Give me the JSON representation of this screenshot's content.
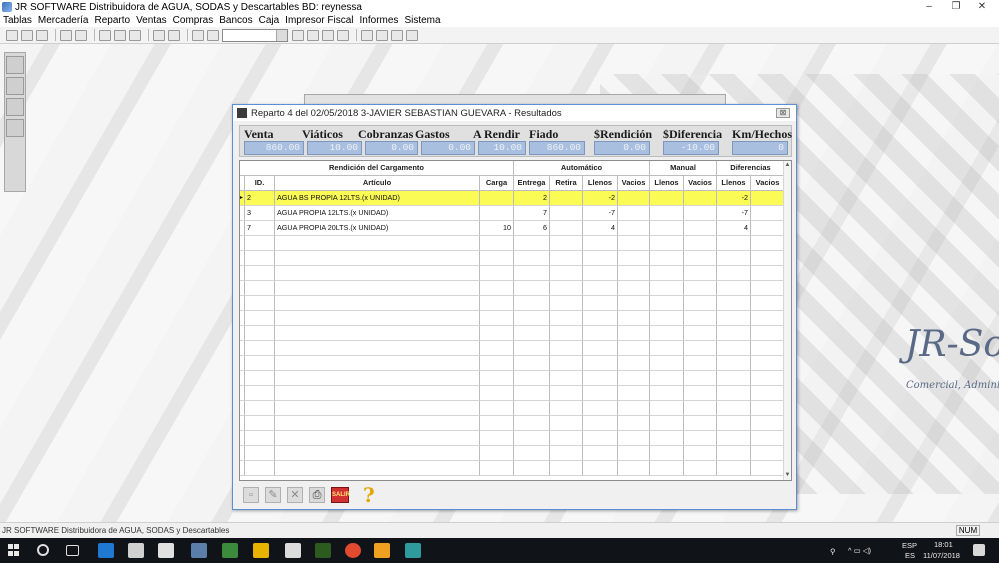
{
  "app": {
    "title": "JR SOFTWARE Distribuidora de AGUA, SODAS y Descartables BD: reynessa",
    "window_controls": [
      "–",
      "❐",
      "✕"
    ]
  },
  "menu": [
    "Tablas",
    "Mercadería",
    "Reparto",
    "Ventas",
    "Compras",
    "Bancos",
    "Caja",
    "Impresor Fiscal",
    "Informes",
    "Sistema"
  ],
  "branding": {
    "logo_text": "JR-So",
    "subtitle": "Comercial, Administr"
  },
  "dialog": {
    "title": "Reparto 4 del 02/05/2018 3-JAVIER SEBASTIAN GUEVARA - Resultados",
    "close_label": "⊠",
    "summary": {
      "venta": {
        "label": "Venta",
        "value": "860.00"
      },
      "viaticos": {
        "label": "Viáticos",
        "value": "10.00"
      },
      "cobranzas": {
        "label": "Cobranzas",
        "value": "0.00"
      },
      "gastos": {
        "label": "Gastos",
        "value": "0.00"
      },
      "a_rendir": {
        "label": "A Rendir",
        "value": "10.00"
      },
      "fiado": {
        "label": "Fiado",
        "value": "860.00"
      },
      "rendicion": {
        "label": "$Rendición",
        "value": "0.00"
      },
      "diferencia": {
        "label": "$Diferencia",
        "value": "-10.00"
      },
      "km_hechos": {
        "label": "Km/Hechos",
        "value": "0"
      }
    },
    "grid": {
      "groups": {
        "rendicion": "Rendición del Cargamento",
        "automatico": "Automático",
        "manual": "Manual",
        "diferencias": "Diferencias"
      },
      "columns": [
        "ID.",
        "Artículo",
        "Carga",
        "Entrega",
        "Retira",
        "Llenos",
        "Vacios",
        "Llenos",
        "Vacios",
        "Llenos",
        "Vacios"
      ],
      "rows": [
        {
          "id": "2",
          "articulo": "AGUA BS PROPIA 12LTS.(x UNIDAD)",
          "carga": "",
          "entrega": "2",
          "retira": "",
          "auto_llenos": "-2",
          "auto_vacios": "",
          "man_llenos": "",
          "man_vacios": "",
          "dif_llenos": "-2",
          "dif_vacios": "",
          "selected": true
        },
        {
          "id": "3",
          "articulo": "AGUA PROPIA 12LTS.(x UNIDAD)",
          "carga": "",
          "entrega": "7",
          "retira": "",
          "auto_llenos": "-7",
          "auto_vacios": "",
          "man_llenos": "",
          "man_vacios": "",
          "dif_llenos": "-7",
          "dif_vacios": "",
          "selected": false
        },
        {
          "id": "7",
          "articulo": "AGUA PROPIA 20LTS.(x UNIDAD)",
          "carga": "10",
          "entrega": "6",
          "retira": "",
          "auto_llenos": "4",
          "auto_vacios": "",
          "man_llenos": "",
          "man_vacios": "",
          "dif_llenos": "4",
          "dif_vacios": "",
          "selected": false
        }
      ]
    },
    "bottom": {
      "exit_label": "SALIR",
      "help_label": "?"
    }
  },
  "statusbar": {
    "text": "JR SOFTWARE Distribuidora de AGUA, SODAS y Descartables",
    "num": "NUM"
  },
  "taskbar": {
    "lang_top": "ESP",
    "lang_bottom": "ES",
    "time": "18:01",
    "date": "11/07/2018"
  },
  "colors": {
    "selected_row": "#fbfb55",
    "summary_value_bg": "#a8bfdf",
    "dialog_border": "#5a8fd6"
  }
}
